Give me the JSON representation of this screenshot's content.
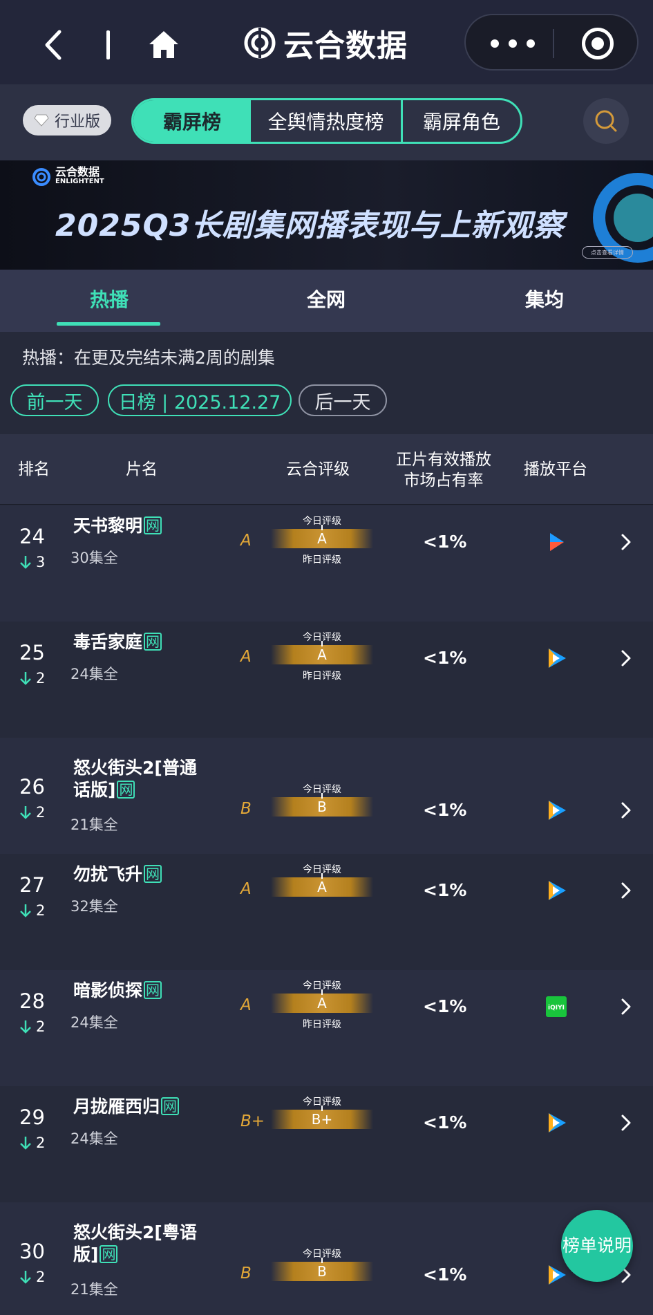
{
  "app": {
    "title": "云合数据"
  },
  "filters": {
    "industry": "行业版",
    "segments": [
      "霸屏榜",
      "全舆情热度榜",
      "霸屏角色"
    ]
  },
  "banner": {
    "brand": "云合数据",
    "brand_en": "ENLIGHTENT",
    "headline": "2025Q3长剧集网播表现与上新观察",
    "cta": "点击查看详情"
  },
  "tabs": [
    "热播",
    "全网",
    "集均"
  ],
  "description": "热播：在更及完结未满2周的剧集",
  "date_nav": {
    "prev": "前一天",
    "current": "日榜 | 2025.12.27",
    "next": "后一天"
  },
  "columns": {
    "rank": "排名",
    "name": "片名",
    "grade": "云合评级",
    "share": "正片有效播放市场占有率",
    "platform": "播放平台"
  },
  "grade_labels": {
    "today": "今日评级",
    "yesterday": "昨日评级"
  },
  "net_tag": "网",
  "rows": [
    {
      "rank": "24",
      "change": "3",
      "title": "天书黎明",
      "episodes": "30集全",
      "grade": "A",
      "today_grade": "A",
      "has_yesterday": true,
      "share": "<1%",
      "platform": "youku"
    },
    {
      "rank": "25",
      "change": "2",
      "title": "毒舌家庭",
      "episodes": "24集全",
      "grade": "A",
      "today_grade": "A",
      "has_yesterday": true,
      "share": "<1%",
      "platform": "tencent"
    },
    {
      "rank": "26",
      "change": "2",
      "title": "怒火街头2[普通话版]",
      "episodes": "21集全",
      "grade": "B",
      "today_grade": "B",
      "has_yesterday": false,
      "share": "<1%",
      "platform": "tencent"
    },
    {
      "rank": "27",
      "change": "2",
      "title": "勿扰飞升",
      "episodes": "32集全",
      "grade": "A",
      "today_grade": "A",
      "has_yesterday": false,
      "share": "<1%",
      "platform": "tencent"
    },
    {
      "rank": "28",
      "change": "2",
      "title": "暗影侦探",
      "episodes": "24集全",
      "grade": "A",
      "today_grade": "A",
      "has_yesterday": true,
      "share": "<1%",
      "platform": "iqiyi"
    },
    {
      "rank": "29",
      "change": "2",
      "title": "月拢雁西归",
      "episodes": "24集全",
      "grade": "B+",
      "today_grade": "B+",
      "has_yesterday": false,
      "share": "<1%",
      "platform": "tencent"
    },
    {
      "rank": "30",
      "change": "2",
      "title": "怒火街头2[粤语版]",
      "episodes": "21集全",
      "grade": "B",
      "today_grade": "B",
      "has_yesterday": false,
      "share": "<1%",
      "platform": "tencent"
    }
  ],
  "fab": "榜单说明",
  "colors": {
    "accent": "#3fe0b7",
    "grade": "#e3a838",
    "bg": "#262a3a"
  }
}
